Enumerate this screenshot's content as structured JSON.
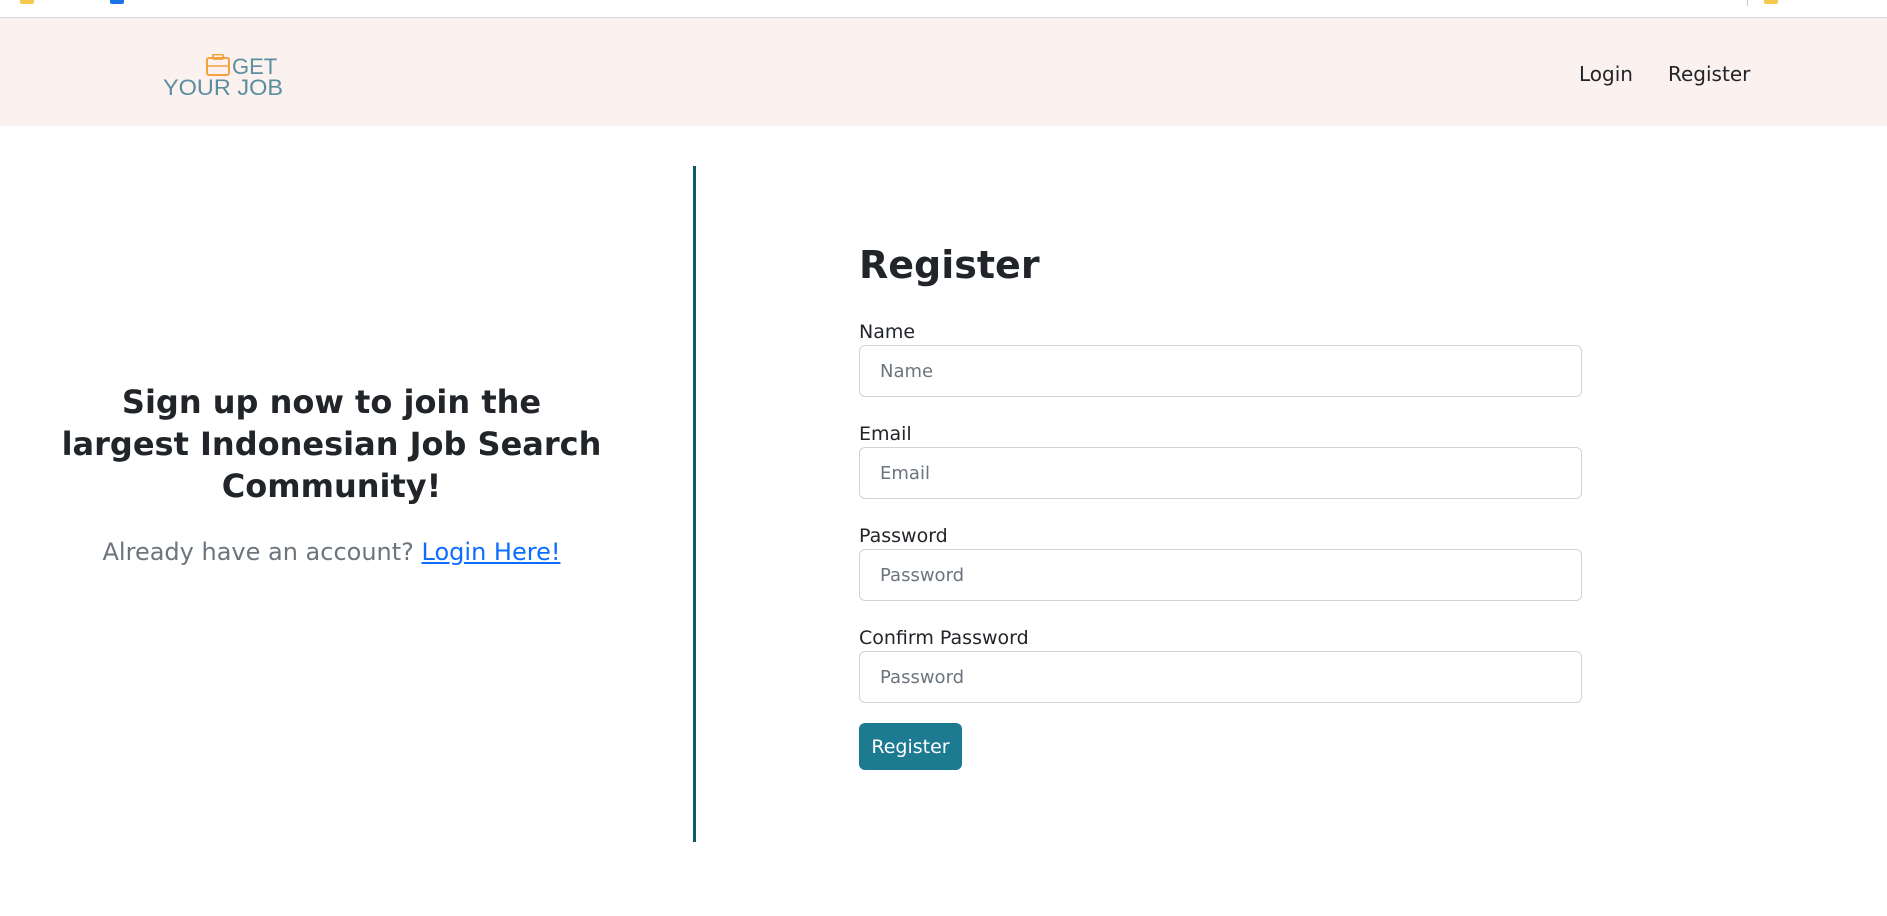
{
  "brand": {
    "logo_word_top": "GET",
    "logo_word_bottom": "YOUR JOB",
    "logo_icon": "briefcase-icon",
    "colors": {
      "navbar_bg": "#fbf1ef",
      "accent": "#1c7a91",
      "divider": "#0b5c66",
      "logo_orange": "#f5a13c",
      "logo_teal": "#5a8fa0"
    }
  },
  "navbar": {
    "login_label": "Login",
    "register_label": "Register"
  },
  "left": {
    "tagline": "Sign up now to join the largest Indonesian Job Search Community!",
    "account_prompt": "Already have an account?",
    "login_link": "Login Here!"
  },
  "form": {
    "title": "Register",
    "name_label": "Name",
    "name_placeholder": "Name",
    "email_label": "Email",
    "email_placeholder": "Email",
    "password_label": "Password",
    "password_placeholder": "Password",
    "confirm_label": "Confirm Password",
    "confirm_placeholder": "Password",
    "submit_label": "Register"
  }
}
